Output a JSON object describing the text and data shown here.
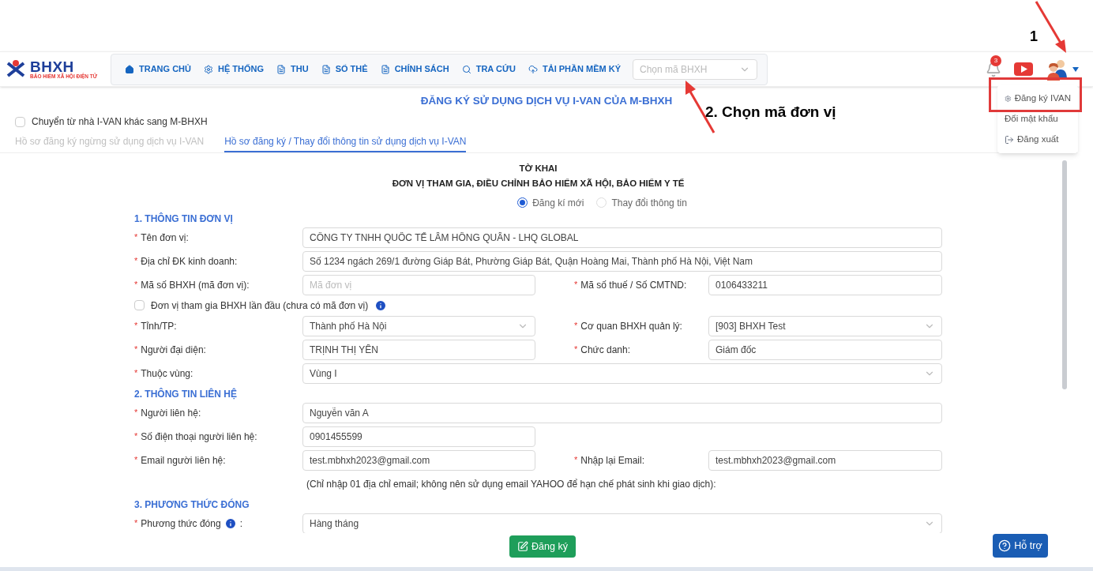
{
  "logo": {
    "title": "BHXH",
    "subtitle": "BẢO HIỂM XÃ HỘI ĐIỆN TỬ"
  },
  "nav": [
    {
      "label": "TRANG CHỦ",
      "kind": "home"
    },
    {
      "label": "HỆ THỐNG",
      "kind": "gear"
    },
    {
      "label": "THU",
      "kind": "doc"
    },
    {
      "label": "SỔ THẺ",
      "kind": "doc"
    },
    {
      "label": "CHÍNH SÁCH",
      "kind": "doc"
    },
    {
      "label": "TRA CỨU",
      "kind": "search"
    },
    {
      "label": "TẢI PHẦN MỀM KÝ",
      "kind": "cloud"
    }
  ],
  "unit_select": {
    "placeholder": "Chọn mã BHXH"
  },
  "notifications": {
    "count": "3"
  },
  "user_menu": {
    "expanded": true,
    "items": [
      {
        "label": "Đăng ký IVAN",
        "kind": "gear"
      },
      {
        "label": "Đổi mật khẩu",
        "kind": "plain"
      },
      {
        "label": "Đăng xuất",
        "kind": "logout"
      }
    ]
  },
  "annotations": [
    {
      "label": "1",
      "kind": "arrow-down"
    },
    {
      "label": "2. Chọn mã đơn vị",
      "kind": "arrow-up"
    }
  ],
  "page_title": "ĐĂNG KÝ SỬ DỤNG DỊCH VỤ I-VAN CỦA M-BHXH",
  "transfer_option": {
    "label": "Chuyển từ nhà I-VAN khác sang M-BHXH",
    "checked": false
  },
  "tabs": [
    {
      "label": "Hồ sơ đăng ký ngừng sử dụng dịch vụ I-VAN",
      "selected": false
    },
    {
      "label": "Hồ sơ đăng ký / Thay đổi thông tin sử dụng dịch vụ I-VAN",
      "selected": true
    }
  ],
  "form": {
    "title": "TỜ KHAI",
    "subtitle": "ĐƠN VỊ THAM GIA, ĐIỀU CHỈNH BẢO HIỂM XÃ HỘI, BẢO HIỂM Y TẾ",
    "modes": [
      {
        "label": "Đăng kí mới",
        "selected": true
      },
      {
        "label": "Thay đổi thông tin",
        "selected": false
      }
    ],
    "sections": [
      {
        "title": "1. THÔNG TIN ĐƠN VỊ",
        "rows": [
          {
            "kind": "wide",
            "fields": [
              {
                "mark": "*",
                "label": "Tên đơn vị:",
                "kind": "input",
                "value": "CÔNG TY TNHH QUỐC TẾ LÂM HỒNG QUÂN - LHQ GLOBAL"
              }
            ]
          },
          {
            "kind": "wide",
            "fields": [
              {
                "mark": "*",
                "label": "Địa chỉ ĐK kinh doanh:",
                "kind": "input",
                "value": "Số 1234 ngách 269/1 đường Giáp Bát, Phường Giáp Bát, Quận Hoàng Mai, Thành phố Hà Nội, Việt Nam"
              }
            ]
          },
          {
            "kind": "pair",
            "fields": [
              {
                "mark": "*",
                "label": "Mã số BHXH (mã đơn vị):",
                "kind": "input",
                "placeholder": "Mã đơn vị"
              },
              {
                "mark": "*",
                "label": "Mã số thuế / Số CMTND:",
                "kind": "input",
                "value": "0106433211"
              }
            ]
          },
          {
            "kind": "checkbox",
            "label": "Đơn vị tham gia BHXH lần đầu (chưa có mã đơn vị)",
            "checked": false
          },
          {
            "kind": "pair",
            "fields": [
              {
                "mark": "*",
                "label": "Tỉnh/TP:",
                "kind": "select",
                "value": "Thành phố Hà Nội"
              },
              {
                "mark": "*",
                "label": "Cơ quan BHXH quản lý:",
                "kind": "select",
                "value": "[903] BHXH Test"
              }
            ]
          },
          {
            "kind": "pair",
            "fields": [
              {
                "mark": "*",
                "label": "Người đại diện:",
                "kind": "input",
                "value": "TRỊNH THỊ YÊN"
              },
              {
                "mark": "*",
                "label": "Chức danh:",
                "kind": "input",
                "value": "Giám đốc"
              }
            ]
          },
          {
            "kind": "wide",
            "fields": [
              {
                "mark": "*",
                "label": "Thuộc vùng:",
                "kind": "select",
                "value": "Vùng I"
              }
            ]
          }
        ]
      },
      {
        "title": "2. THÔNG TIN LIÊN HỆ",
        "rows": [
          {
            "kind": "wide",
            "fields": [
              {
                "mark": "*",
                "label": "Người liên hệ:",
                "kind": "input",
                "value": "Nguyễn văn A"
              }
            ]
          },
          {
            "kind": "half",
            "fields": [
              {
                "mark": "*",
                "label": "Số điện thoại người liên hệ:",
                "kind": "input",
                "value": "0901455599"
              }
            ]
          },
          {
            "kind": "pair",
            "fields": [
              {
                "mark": "*",
                "label": "Email người liên hệ:",
                "kind": "input",
                "value": "test.mbhxh2023@gmail.com"
              },
              {
                "mark": "*",
                "label": "Nhập lại Email:",
                "kind": "input",
                "value": "test.mbhxh2023@gmail.com"
              }
            ]
          },
          {
            "kind": "note",
            "label": "(Chỉ nhập 01 địa chỉ email; không nên sử dụng email YAHOO để hạn chế phát sinh khi giao dịch):"
          }
        ]
      },
      {
        "title": "3. PHƯƠNG THỨC ĐÓNG",
        "rows": [
          {
            "kind": "wide",
            "fields": [
              {
                "mark": "*",
                "label": "Phương thức đóng",
                "kind": "select",
                "value": "Hàng tháng",
                "info": true,
                "suffix": ":"
              }
            ]
          }
        ]
      }
    ]
  },
  "submit_button": "Đăng ký",
  "help_button": "Hỗ trợ"
}
